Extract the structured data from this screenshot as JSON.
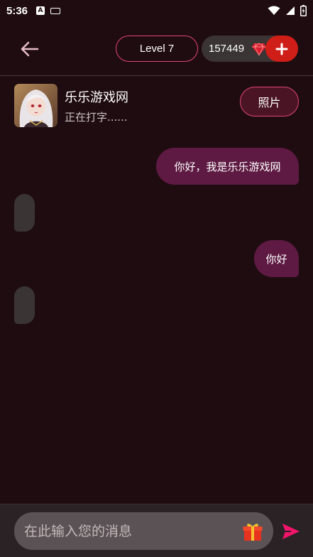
{
  "status_bar": {
    "time": "5:36",
    "a_badge": "A",
    "icons": [
      "keyboard-icon",
      "wifi-icon",
      "signal-icon",
      "battery-charging-icon"
    ]
  },
  "header": {
    "back_icon": "arrow-left-icon",
    "level_label": "Level 7",
    "coins": "157449",
    "coin_icon": "gem-icon",
    "add_icon": "plus-icon"
  },
  "profile": {
    "name": "乐乐游戏网",
    "status": "正在打字......",
    "photo_button": "照片"
  },
  "messages": [
    {
      "sender": "user",
      "text": "你好，我是乐乐游戏网"
    },
    {
      "sender": "bot",
      "text": ""
    },
    {
      "sender": "user",
      "text": "你好"
    },
    {
      "sender": "bot",
      "text": ""
    }
  ],
  "composer": {
    "placeholder": "在此输入您的消息",
    "gift_icon": "gift-icon",
    "send_icon": "send-icon"
  },
  "colors": {
    "background": "#1f0c10",
    "accent": "#e0457a",
    "user_bubble": "#5e1a42",
    "bot_bubble": "#3a3435",
    "add_button": "#cf1d17",
    "send": "#f0156a"
  }
}
